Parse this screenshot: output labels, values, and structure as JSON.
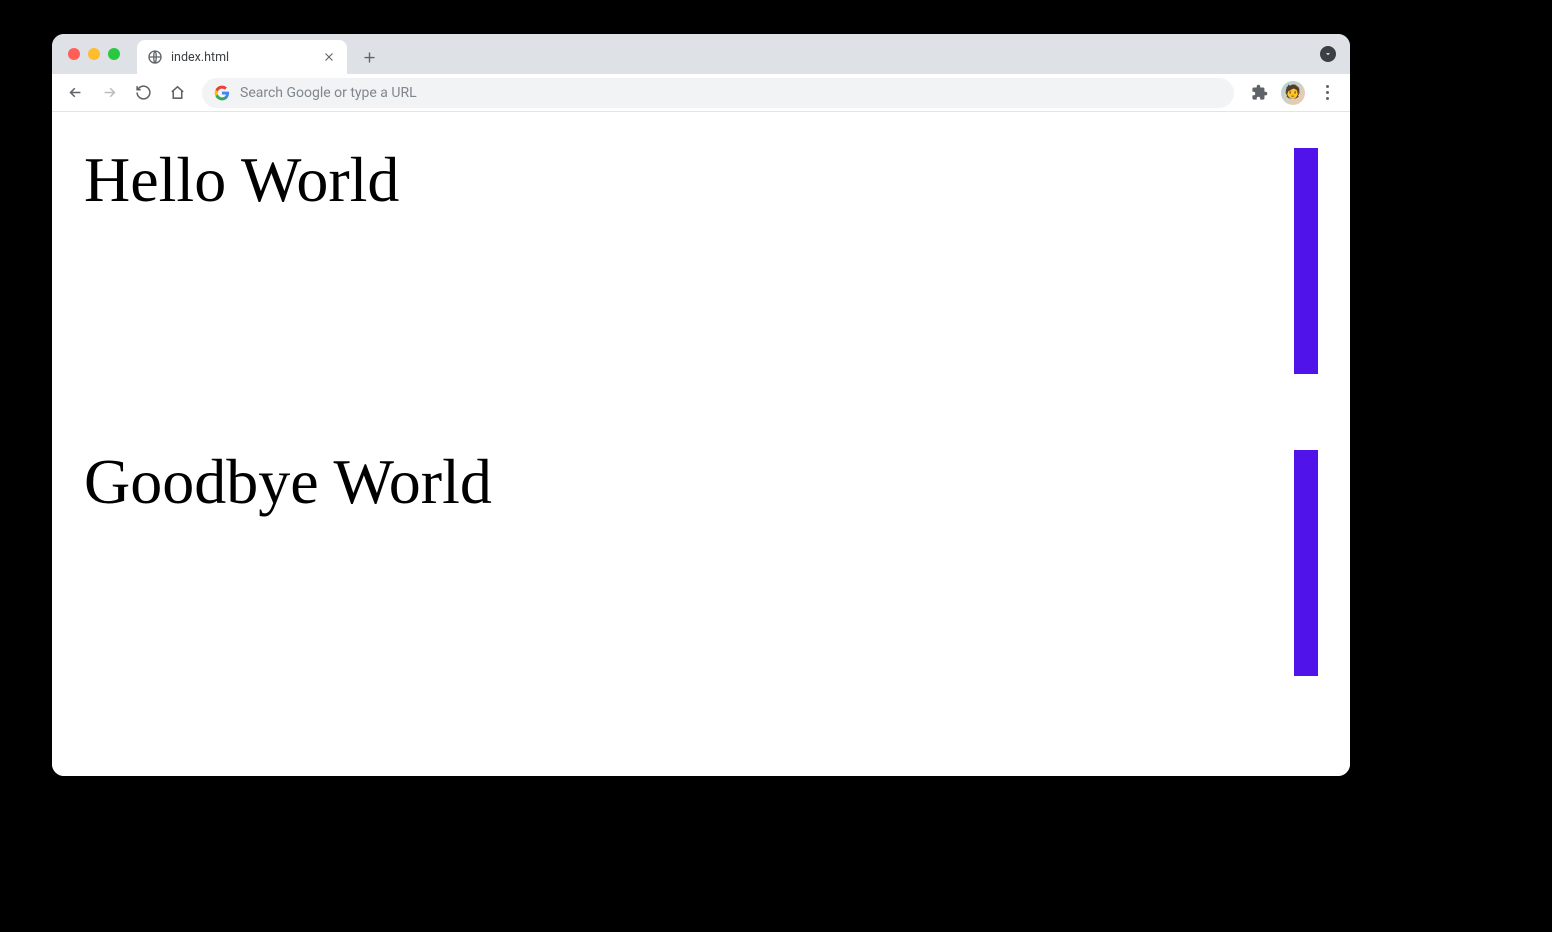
{
  "browser": {
    "tab_title": "index.html",
    "omnibox_placeholder": "Search Google or type a URL"
  },
  "page": {
    "sections": [
      {
        "heading": "Hello World"
      },
      {
        "heading": "Goodbye World"
      }
    ],
    "accent_color": "#5014eb"
  }
}
